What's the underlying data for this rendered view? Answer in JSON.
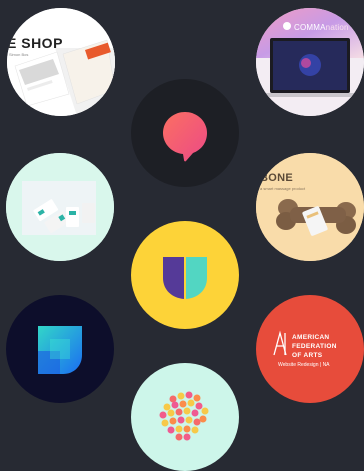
{
  "tiles": {
    "shop": {
      "title": "E SHOP",
      "subtitle": "Simon Bos"
    },
    "comma": {
      "brand": "COMMA",
      "brand_suffix": "nation"
    },
    "bone": {
      "title": "BONE",
      "subtitle": "a smart massage product"
    },
    "afa": {
      "line1": "AMERICAN",
      "line2": "FEDERATION",
      "line3": "OF ARTS",
      "caption": "Website Redesign | NA"
    }
  },
  "colors": {
    "background": "#272a33",
    "chat_bubble": "#f25773",
    "u_yellow": "#fdd338",
    "afa_red": "#e74c3b"
  }
}
